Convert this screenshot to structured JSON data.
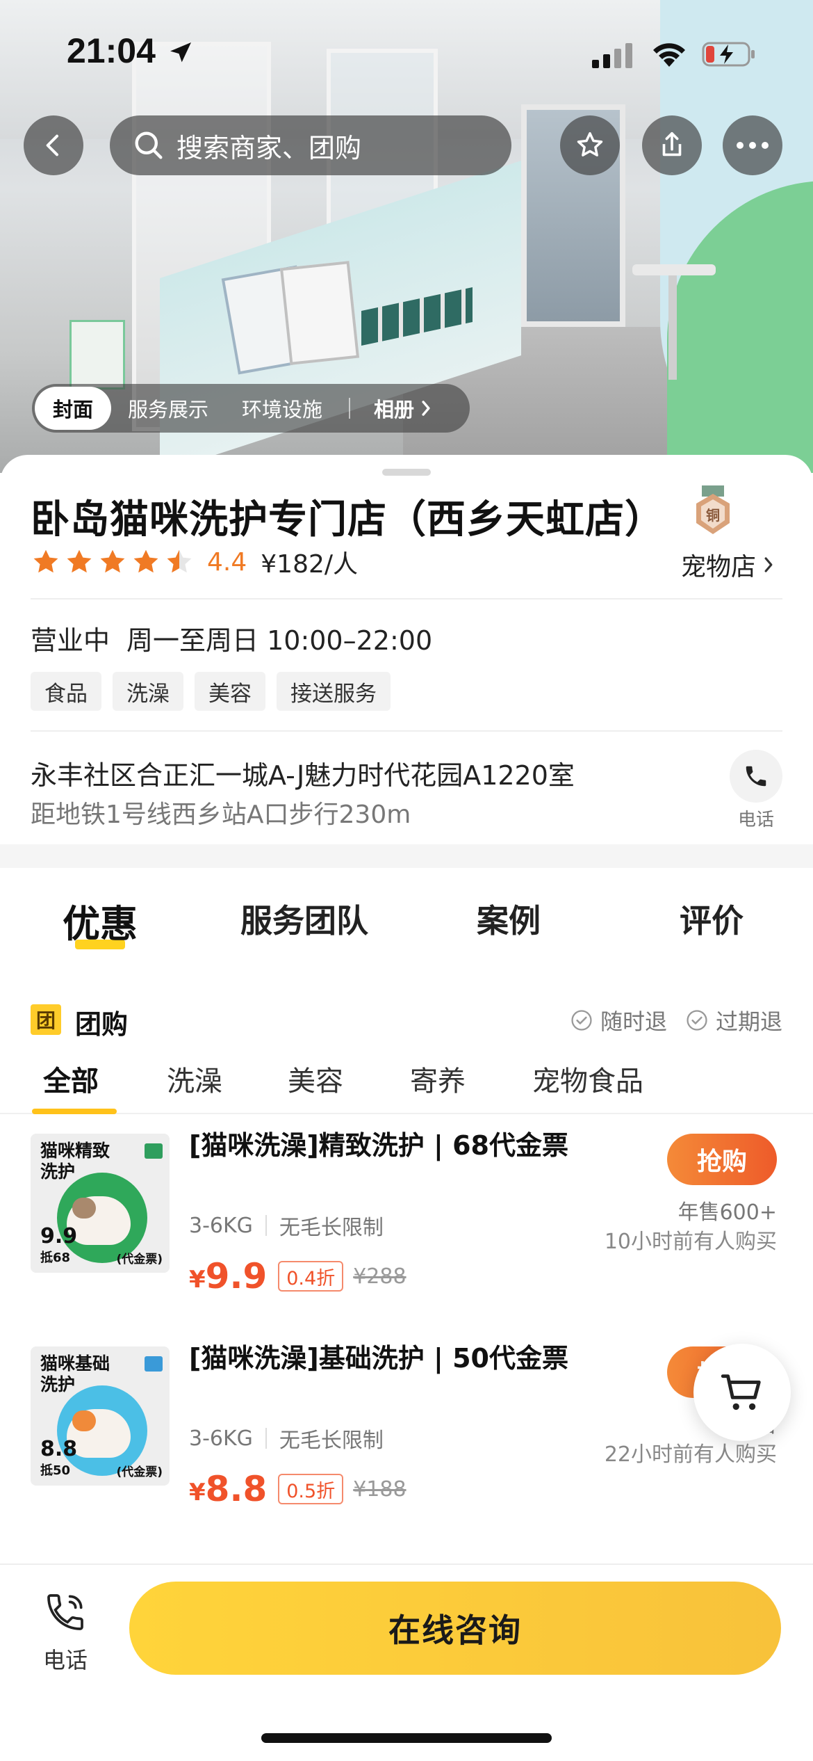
{
  "status_bar": {
    "time": "21:04"
  },
  "header": {
    "search_placeholder": "搜索商家、团购"
  },
  "album_tabs": [
    {
      "label": "封面",
      "active": true
    },
    {
      "label": "服务展示",
      "active": false
    },
    {
      "label": "环境设施",
      "active": false
    }
  ],
  "album_link": "相册",
  "shop": {
    "name": "卧岛猫咪洗护专门店（西乡天虹店）",
    "medal_text": "铜",
    "rating": 4.4,
    "rating_text": "4.4",
    "per_person": "¥182/人",
    "category": "宠物店",
    "open_status": "营业中",
    "hours": "周一至周日 10:00–22:00",
    "tags": [
      "食品",
      "洗澡",
      "美容",
      "接送服务"
    ],
    "address": "永丰社区合正汇一城A-J魅力时代花园A1220室",
    "subway": "距地铁1号线西乡站A口步行230m",
    "call_label": "电话"
  },
  "main_tabs": [
    {
      "label": "优惠",
      "active": true
    },
    {
      "label": "服务团队",
      "active": false
    },
    {
      "label": "案例",
      "active": false
    },
    {
      "label": "评价",
      "active": false
    }
  ],
  "group_buy": {
    "badge": "团",
    "title": "团购",
    "guarantees": [
      "随时退",
      "过期退"
    ],
    "sub_tabs": [
      {
        "label": "全部",
        "active": true
      },
      {
        "label": "洗澡",
        "active": false
      },
      {
        "label": "美容",
        "active": false
      },
      {
        "label": "寄养",
        "active": false
      },
      {
        "label": "宠物食品",
        "active": false
      }
    ],
    "deals": [
      {
        "thumb_title": "猫咪精致洗护",
        "thumb_price": "9.9",
        "thumb_offset": "抵68",
        "thumb_coupon": "(代金票)",
        "thumb_color": "#2fa85a",
        "title": "[猫咪洗澡]精致洗护 | 68代金票",
        "spec1": "3-6KG",
        "spec2": "无毛长限制",
        "currency": "¥",
        "price": "9.9",
        "discount": "0.4折",
        "original": "¥288",
        "buy_label": "抢购",
        "sold": "年售600+",
        "recent": "10小时前有人购买"
      },
      {
        "thumb_title": "猫咪基础洗护",
        "thumb_price": "8.8",
        "thumb_offset": "抵50",
        "thumb_coupon": "(代金票)",
        "thumb_color": "#4bbfe6",
        "title": "[猫咪洗澡]基础洗护 | 50代金票",
        "spec1": "3-6KG",
        "spec2": "无毛长限制",
        "currency": "¥",
        "price": "8.8",
        "discount": "0.5折",
        "original": "¥188",
        "buy_label": "抢购",
        "sold": "年售",
        "recent": "22小时前有人购买"
      }
    ]
  },
  "bottom_bar": {
    "phone_label": "电话",
    "consult_label": "在线咨询"
  },
  "colors": {
    "accent_orange": "#f0522a",
    "star_orange": "#f07a24",
    "brand_yellow": "#ffd21f"
  }
}
